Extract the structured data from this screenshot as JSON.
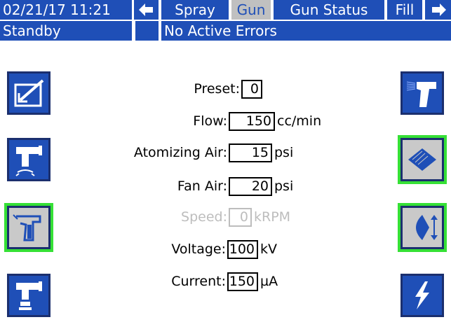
{
  "header": {
    "datetime": "02/21/17 11:21",
    "tabs": [
      {
        "label": "Spray",
        "selected": false
      },
      {
        "label": "Gun",
        "selected": true
      },
      {
        "label": "Gun Status",
        "selected": false
      },
      {
        "label": "Fill",
        "selected": false
      }
    ]
  },
  "status": {
    "mode": "Standby",
    "errors": "No Active Errors"
  },
  "form": {
    "preset": {
      "label": "Preset:",
      "value": "0",
      "unit": ""
    },
    "flow": {
      "label": "Flow:",
      "value": "150",
      "unit": "cc/min"
    },
    "atomizing_air": {
      "label": "Atomizing Air:",
      "value": "15",
      "unit": "psi"
    },
    "fan_air": {
      "label": "Fan Air:",
      "value": "20",
      "unit": "psi"
    },
    "speed": {
      "label": "Speed:",
      "value": "0",
      "unit": "kRPM",
      "disabled": true
    },
    "voltage": {
      "label": "Voltage:",
      "value": "100",
      "unit": "kV"
    },
    "current": {
      "label": "Current:",
      "value": "150",
      "unit": "µA"
    }
  },
  "left_buttons": [
    {
      "icon": "edit-icon",
      "active": false
    },
    {
      "icon": "rotary-applicator-icon",
      "active": false
    },
    {
      "icon": "spray-gun-icon",
      "active": true
    },
    {
      "icon": "rotary-bell-icon",
      "active": false
    }
  ],
  "right_buttons": [
    {
      "icon": "spray-gun-trigger-icon",
      "active": false
    },
    {
      "icon": "fan-pattern-icon",
      "active": true
    },
    {
      "icon": "fan-width-adjust-icon",
      "active": true
    },
    {
      "icon": "high-voltage-icon",
      "active": false
    }
  ],
  "colors": {
    "primary_blue": "#1f4fb7",
    "selected_tab_bg": "#c0c0c0",
    "active_outline": "#36e036",
    "disabled_text": "#bdbdbd"
  }
}
